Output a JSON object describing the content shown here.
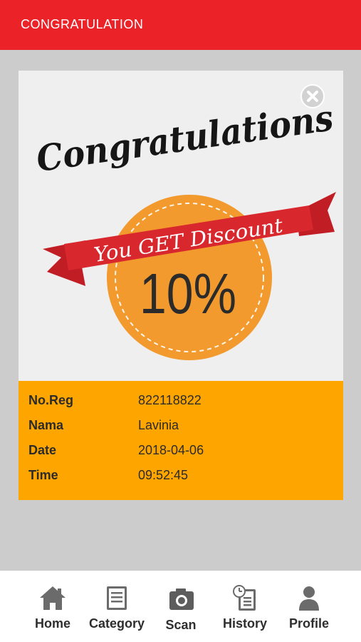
{
  "appbar": {
    "title": "CONGRATULATION"
  },
  "banner": {
    "heading": "Congratulations",
    "ribbon_text": "You GET Discount",
    "discount": "10%"
  },
  "details": {
    "rows": [
      {
        "label": "No.Reg",
        "value": "822118822"
      },
      {
        "label": "Nama",
        "value": "Lavinia"
      },
      {
        "label": "Date",
        "value": "2018-04-06"
      },
      {
        "label": "Time",
        "value": "09:52:45"
      }
    ]
  },
  "nav": {
    "items": [
      {
        "label": "Home",
        "icon": "home-icon"
      },
      {
        "label": "Category",
        "icon": "document-icon"
      },
      {
        "label": "Scan",
        "icon": "camera-icon"
      },
      {
        "label": "History",
        "icon": "history-icon"
      },
      {
        "label": "Profile",
        "icon": "person-icon"
      }
    ]
  },
  "colors": {
    "appbar": "#ec2229",
    "ribbon": "#d9272e",
    "badge": "#f29a2e",
    "details_bg": "#ffa500",
    "page_bg": "#cccccc"
  }
}
